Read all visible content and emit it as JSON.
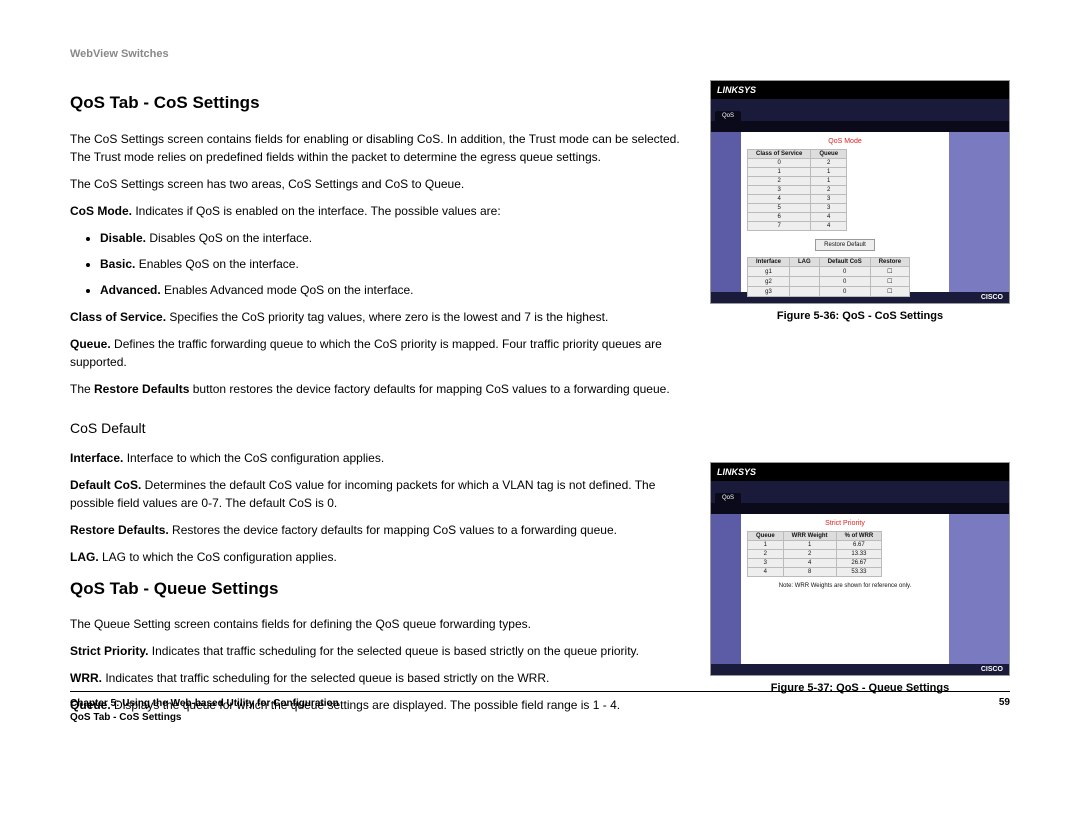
{
  "running_header": "WebView Switches",
  "section1": {
    "title": "QoS Tab - CoS Settings",
    "intro": "The CoS Settings screen contains fields for enabling or disabling CoS. In addition, the Trust mode can be selected. The Trust mode relies on predefined fields within the packet to determine the egress queue settings.",
    "areas": "The CoS Settings screen has two areas, CoS Settings and CoS to Queue.",
    "cos_mode_label": "CoS Mode.",
    "cos_mode_text": " Indicates if QoS is enabled on the interface. The possible values are:",
    "bullets": [
      {
        "bold": "Disable.",
        "text": " Disables QoS on the interface."
      },
      {
        "bold": "Basic.",
        "text": " Enables QoS on the interface."
      },
      {
        "bold": "Advanced.",
        "text": " Enables Advanced mode QoS on the interface."
      }
    ],
    "class_of_service_label": "Class of Service.",
    "class_of_service_text": " Specifies the CoS priority tag values, where zero is the lowest and 7 is the highest.",
    "queue_label": "Queue.",
    "queue_text": " Defines the traffic forwarding queue to which the CoS priority is mapped. Four traffic priority queues are supported.",
    "restore_pre": "The ",
    "restore_bold": "Restore Defaults",
    "restore_post": " button restores the device factory defaults for mapping CoS values to a forwarding queue."
  },
  "section1b_title": "CoS Default",
  "section1b": {
    "interface_label": "Interface.",
    "interface_text": " Interface to which the CoS configuration applies.",
    "defaultcos_label": "Default CoS.",
    "defaultcos_text": " Determines the default CoS value for incoming packets for which a VLAN tag is not defined. The possible field values are 0-7. The default CoS is 0.",
    "restore2_label": "Restore Defaults.",
    "restore2_text": " Restores the device factory defaults for mapping CoS values to a forwarding queue.",
    "lag_label": "LAG.",
    "lag_text": " LAG to which the CoS configuration applies."
  },
  "section2": {
    "title": "QoS Tab - Queue Settings",
    "intro": "The Queue Setting screen contains fields for defining the QoS queue forwarding types.",
    "strict_label": "Strict Priority.",
    "strict_text": " Indicates that traffic scheduling for the selected queue is based strictly on the queue priority.",
    "wrr_label": "WRR.",
    "wrr_text": " Indicates that traffic scheduling for the selected queue is based strictly on the WRR.",
    "queue_label": "Queue.",
    "queue_text": " Displays the queue for which the queue settings are displayed. The possible field range is 1 - 4."
  },
  "figures": {
    "fig1": {
      "caption": "Figure 5-36: QoS - CoS Settings",
      "brand": "LINKSYS",
      "nav_tab": "QoS",
      "panel_title": "QoS Mode",
      "col1": "Class of Service",
      "col2": "Queue",
      "btn": "Restore Default",
      "footer_icon": "CISCO"
    },
    "fig2": {
      "caption": "Figure 5-37: QoS - Queue Settings",
      "brand": "LINKSYS",
      "nav_tab": "QoS",
      "panel_title": "Strict Priority",
      "note": "Note: WRR Weights are shown for reference only.",
      "col1": "Queue",
      "col2": "WRR Weight",
      "col3": "% of WRR",
      "footer_icon": "CISCO"
    }
  },
  "footer": {
    "line1": "Chapter 5: Using the Web-based Utility for Configuration",
    "line2": "QoS Tab - CoS Settings",
    "page_number": "59"
  }
}
